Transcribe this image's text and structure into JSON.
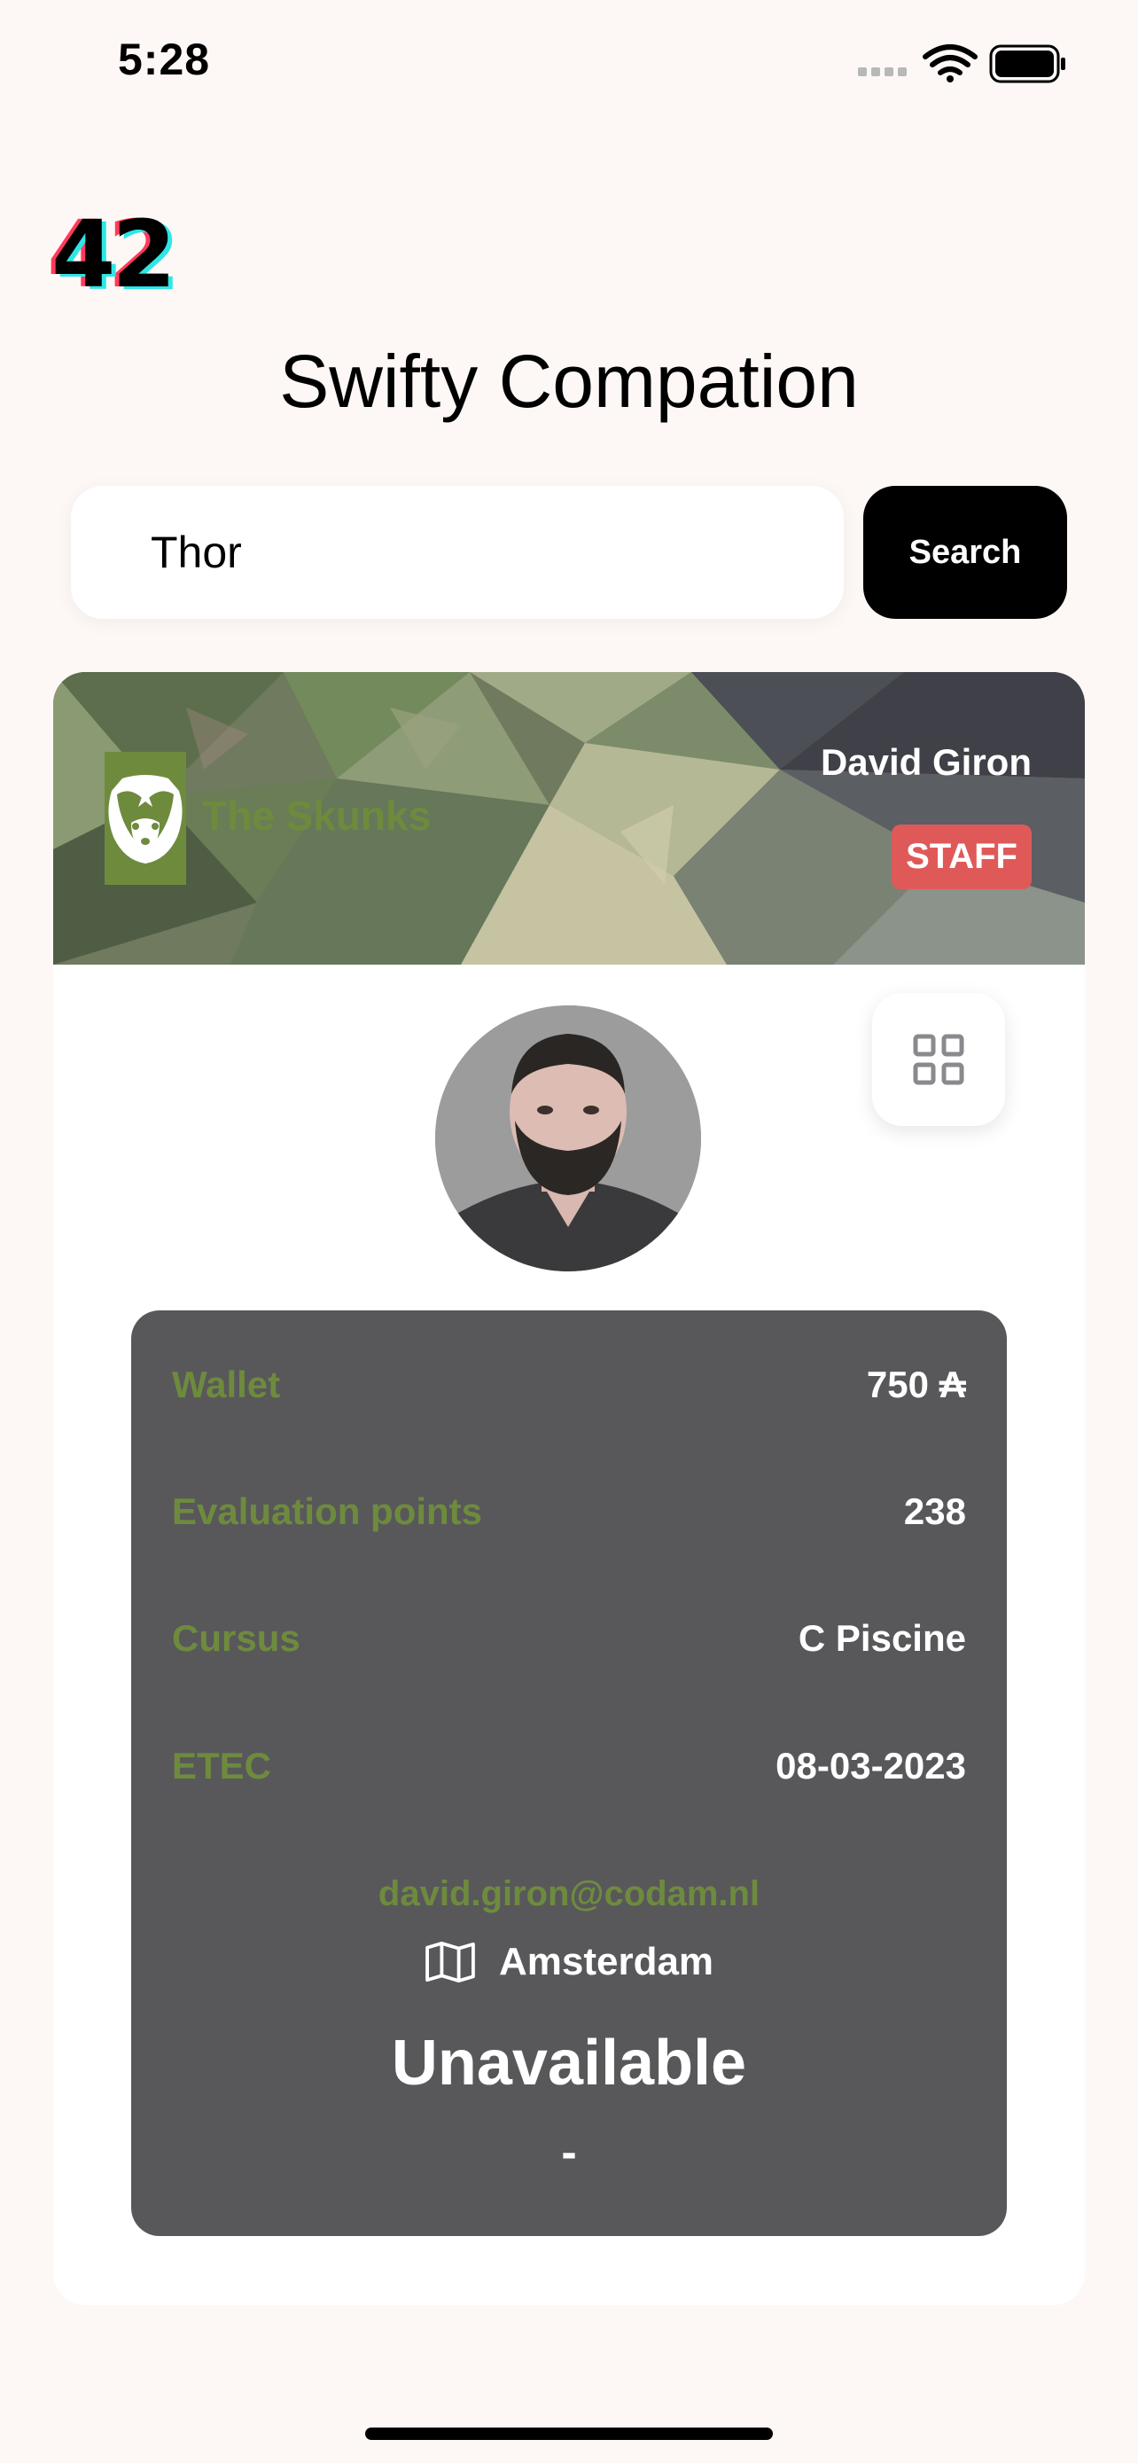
{
  "status_bar": {
    "time": "5:28"
  },
  "logo": {
    "text": "42"
  },
  "app": {
    "title": "Swifty Compation"
  },
  "search": {
    "value": "Thor",
    "button_label": "Search"
  },
  "profile": {
    "coalition_name": "The Skunks",
    "full_name": "David Giron",
    "role_badge": "STAFF",
    "wallet_label": "Wallet",
    "wallet_value": "750 ₳",
    "eval_label": "Evaluation points",
    "eval_value": "238",
    "cursus_label": "Cursus",
    "cursus_value": "C Piscine",
    "etec_label": "ETEC",
    "etec_value": "08-03-2023",
    "email": "david.giron@codam.nl",
    "campus": "Amsterdam",
    "location_status": "Unavailable",
    "location_host": "-"
  },
  "colors": {
    "coalition": "#6e8b3d",
    "staff": "#e05959",
    "panel": "#58585b",
    "background": "#fdf8f6"
  },
  "icons": [
    "cellular-icon",
    "wifi-icon",
    "battery-icon",
    "skunk-icon",
    "qr-grid-icon",
    "map-icon"
  ]
}
